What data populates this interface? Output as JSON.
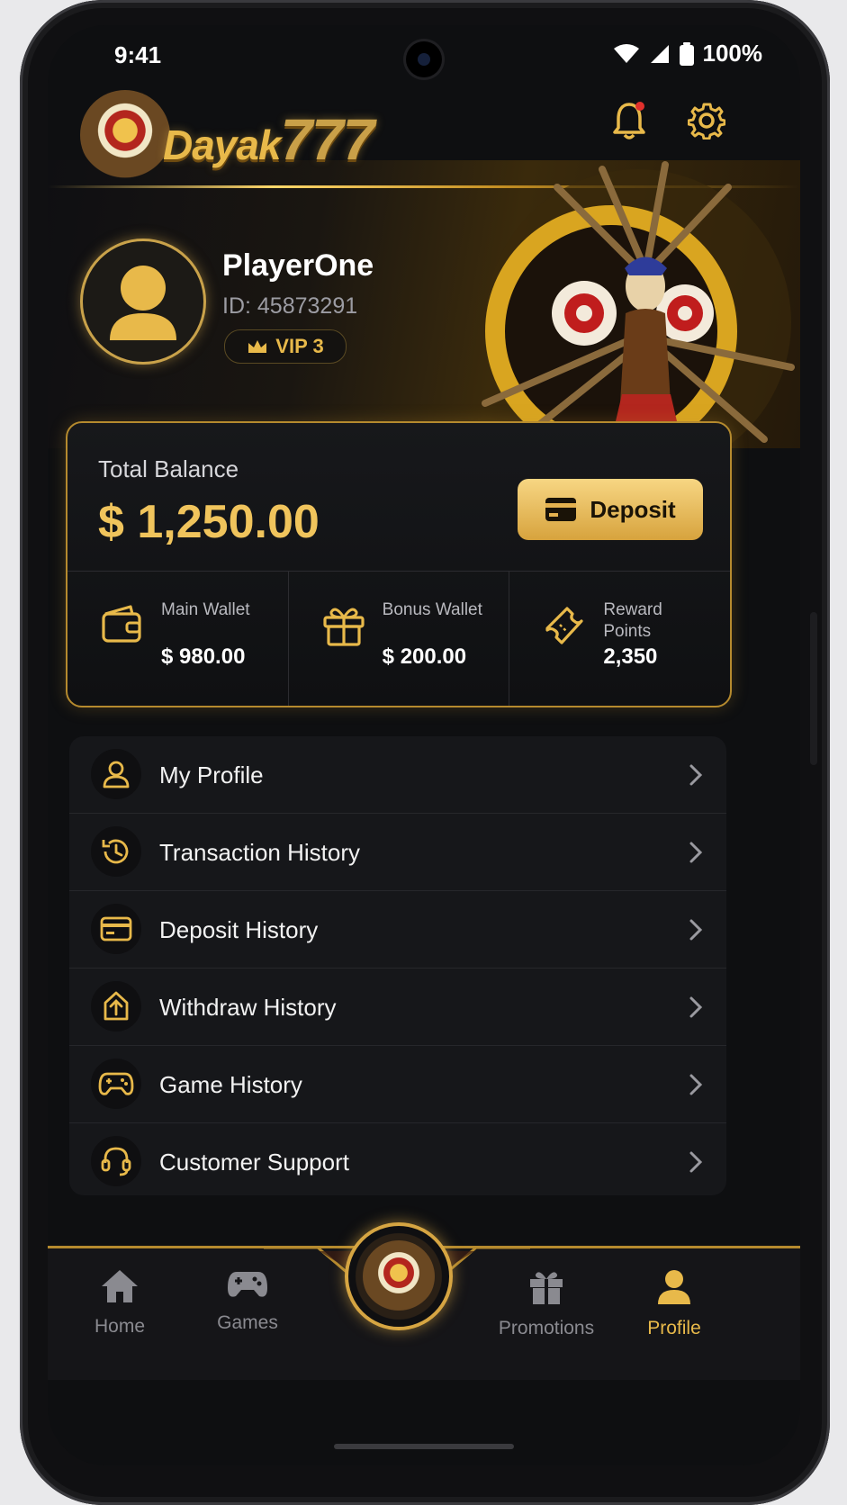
{
  "status_bar": {
    "time": "9:41",
    "battery": "100%"
  },
  "brand": {
    "name": "Dayak",
    "number": "777"
  },
  "profile": {
    "username": "PlayerOne",
    "user_id": "ID: 45873291",
    "vip": "VIP 3"
  },
  "balance": {
    "label": "Total Balance",
    "amount": "$ 1,250.00",
    "deposit_label": "Deposit",
    "wallets": [
      {
        "name": "Main Wallet",
        "value": "$ 980.00",
        "icon": "wallet-icon"
      },
      {
        "name": "Bonus Wallet",
        "value": "$ 200.00",
        "icon": "gift-icon"
      },
      {
        "name": "Reward Points",
        "value": "2,350",
        "icon": "ticket-icon"
      }
    ]
  },
  "menu": [
    {
      "label": "My Profile",
      "icon": "user-icon"
    },
    {
      "label": "Transaction History",
      "icon": "history-icon"
    },
    {
      "label": "Deposit History",
      "icon": "card-icon"
    },
    {
      "label": "Withdraw History",
      "icon": "upload-icon"
    },
    {
      "label": "Game History",
      "icon": "gamepad-icon"
    },
    {
      "label": "Customer Support",
      "icon": "headset-icon"
    }
  ],
  "nav": {
    "items": [
      {
        "label": "Home",
        "icon": "home-icon"
      },
      {
        "label": "Games",
        "icon": "gamepad-icon"
      },
      {
        "label": "Promotions",
        "icon": "gift-icon"
      },
      {
        "label": "Profile",
        "icon": "user-icon"
      }
    ],
    "active": "Profile"
  },
  "colors": {
    "accent": "#e8b94a",
    "background": "#0e0f11",
    "card": "#16171a"
  }
}
